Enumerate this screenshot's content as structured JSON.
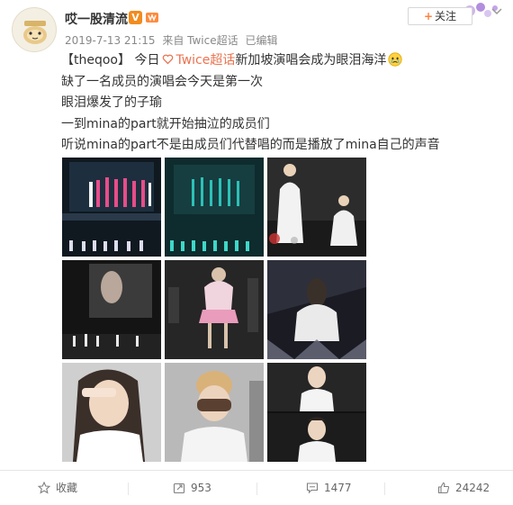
{
  "post": {
    "author": "哎一股清流",
    "verified_badge": "V",
    "follow_label": "关注",
    "follow_plus": "+",
    "meta": {
      "time": "2019-7-13 21:15",
      "source": "来自 Twice超话",
      "edited": "已编辑"
    },
    "lines": {
      "l1_prefix": "【theqoo】 今日",
      "l1_topic": "Twice超话",
      "l1_rest": "新加坡演唱会成为眼泪海洋",
      "l2": "缺了一名成员的演唱会今天是第一次",
      "l3": "眼泪爆发了的子瑜",
      "l4": "一到mina的part就开始抽泣的成员们",
      "l5": "听说mina的part不是由成员们代替唱的而是播放了mina自己的声音"
    },
    "photos_count": 9
  },
  "footer": {
    "favorite_label": "收藏",
    "repost_count": "953",
    "comment_count": "1477",
    "like_count": "24242"
  },
  "colors": {
    "topic": "#eb7350",
    "follow_plus": "#ff8140",
    "badge": "#f28c1e"
  },
  "icons": [
    "avatar",
    "verified-badge-icon",
    "member-icon",
    "chevron-down-icon",
    "topic-icon",
    "crying-emoji-icon",
    "star-icon",
    "repost-icon",
    "comment-icon",
    "like-icon"
  ]
}
